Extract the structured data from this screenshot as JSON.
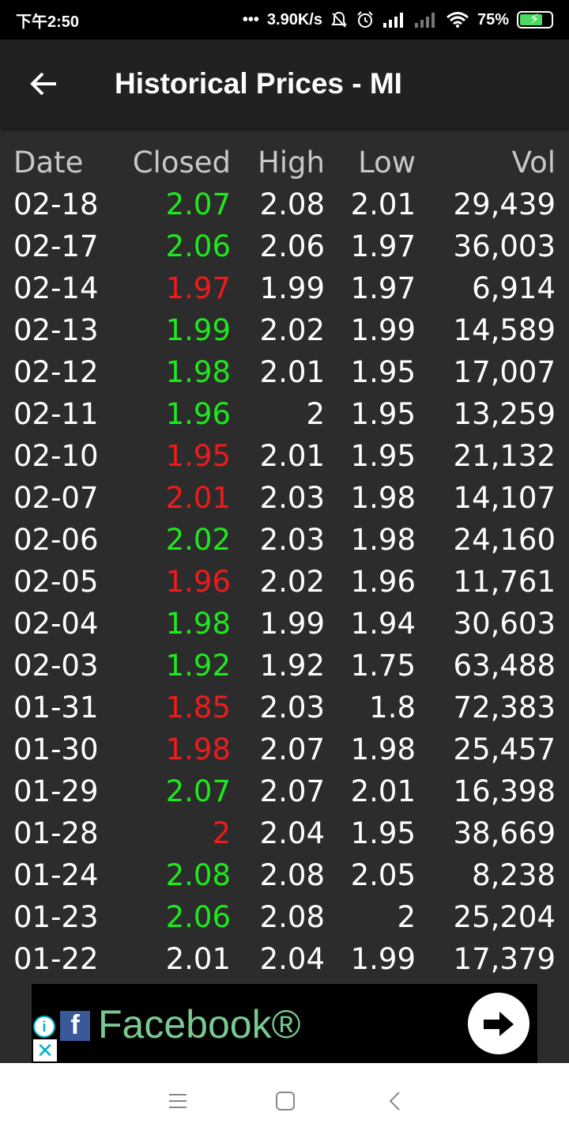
{
  "status_bar": {
    "time": "下午2:50",
    "dots": "•••",
    "speed": "3.90K/s",
    "battery": "75%",
    "icons": [
      "mute-bell-icon",
      "alarm-icon",
      "signal-icon",
      "signal-weak-icon",
      "wifi-icon",
      "battery-charging-icon"
    ]
  },
  "app_bar": {
    "title": "Historical Prices - MI",
    "back_icon": "arrow-left-icon"
  },
  "table": {
    "headers": [
      "Date",
      "Closed",
      "High",
      "Low",
      "Vol"
    ],
    "rows": [
      {
        "date": "02-18",
        "closed": "2.07",
        "high": "2.08",
        "low": "2.01",
        "vol": "29,439",
        "trend": "up"
      },
      {
        "date": "02-17",
        "closed": "2.06",
        "high": "2.06",
        "low": "1.97",
        "vol": "36,003",
        "trend": "up"
      },
      {
        "date": "02-14",
        "closed": "1.97",
        "high": "1.99",
        "low": "1.97",
        "vol": "6,914",
        "trend": "down"
      },
      {
        "date": "02-13",
        "closed": "1.99",
        "high": "2.02",
        "low": "1.99",
        "vol": "14,589",
        "trend": "up"
      },
      {
        "date": "02-12",
        "closed": "1.98",
        "high": "2.01",
        "low": "1.95",
        "vol": "17,007",
        "trend": "up"
      },
      {
        "date": "02-11",
        "closed": "1.96",
        "high": "2",
        "low": "1.95",
        "vol": "13,259",
        "trend": "up"
      },
      {
        "date": "02-10",
        "closed": "1.95",
        "high": "2.01",
        "low": "1.95",
        "vol": "21,132",
        "trend": "down"
      },
      {
        "date": "02-07",
        "closed": "2.01",
        "high": "2.03",
        "low": "1.98",
        "vol": "14,107",
        "trend": "down"
      },
      {
        "date": "02-06",
        "closed": "2.02",
        "high": "2.03",
        "low": "1.98",
        "vol": "24,160",
        "trend": "up"
      },
      {
        "date": "02-05",
        "closed": "1.96",
        "high": "2.02",
        "low": "1.96",
        "vol": "11,761",
        "trend": "down"
      },
      {
        "date": "02-04",
        "closed": "1.98",
        "high": "1.99",
        "low": "1.94",
        "vol": "30,603",
        "trend": "up"
      },
      {
        "date": "02-03",
        "closed": "1.92",
        "high": "1.92",
        "low": "1.75",
        "vol": "63,488",
        "trend": "up"
      },
      {
        "date": "01-31",
        "closed": "1.85",
        "high": "2.03",
        "low": "1.8",
        "vol": "72,383",
        "trend": "down"
      },
      {
        "date": "01-30",
        "closed": "1.98",
        "high": "2.07",
        "low": "1.98",
        "vol": "25,457",
        "trend": "down"
      },
      {
        "date": "01-29",
        "closed": "2.07",
        "high": "2.07",
        "low": "2.01",
        "vol": "16,398",
        "trend": "up"
      },
      {
        "date": "01-28",
        "closed": "2",
        "high": "2.04",
        "low": "1.95",
        "vol": "38,669",
        "trend": "down"
      },
      {
        "date": "01-24",
        "closed": "2.08",
        "high": "2.08",
        "low": "2.05",
        "vol": "8,238",
        "trend": "up"
      },
      {
        "date": "01-23",
        "closed": "2.06",
        "high": "2.08",
        "low": "2",
        "vol": "25,204",
        "trend": "up"
      },
      {
        "date": "01-22",
        "closed": "2.01",
        "high": "2.04",
        "low": "1.99",
        "vol": "17,379",
        "trend": "flat"
      }
    ]
  },
  "colors": {
    "up": "#1ee81e",
    "down": "#ee1b1b",
    "flat": "#ffffff",
    "background": "#2c2c2c",
    "app_bar": "#212121"
  },
  "ad": {
    "text": "Facebook®",
    "info_label": "i",
    "close_label": "✕",
    "brand_letter": "f",
    "icons": [
      "info-icon",
      "close-icon",
      "facebook-logo-icon",
      "arrow-right-icon"
    ]
  },
  "nav_bar": {
    "icons": [
      "menu-icon",
      "home-square-icon",
      "back-chevron-icon"
    ]
  }
}
